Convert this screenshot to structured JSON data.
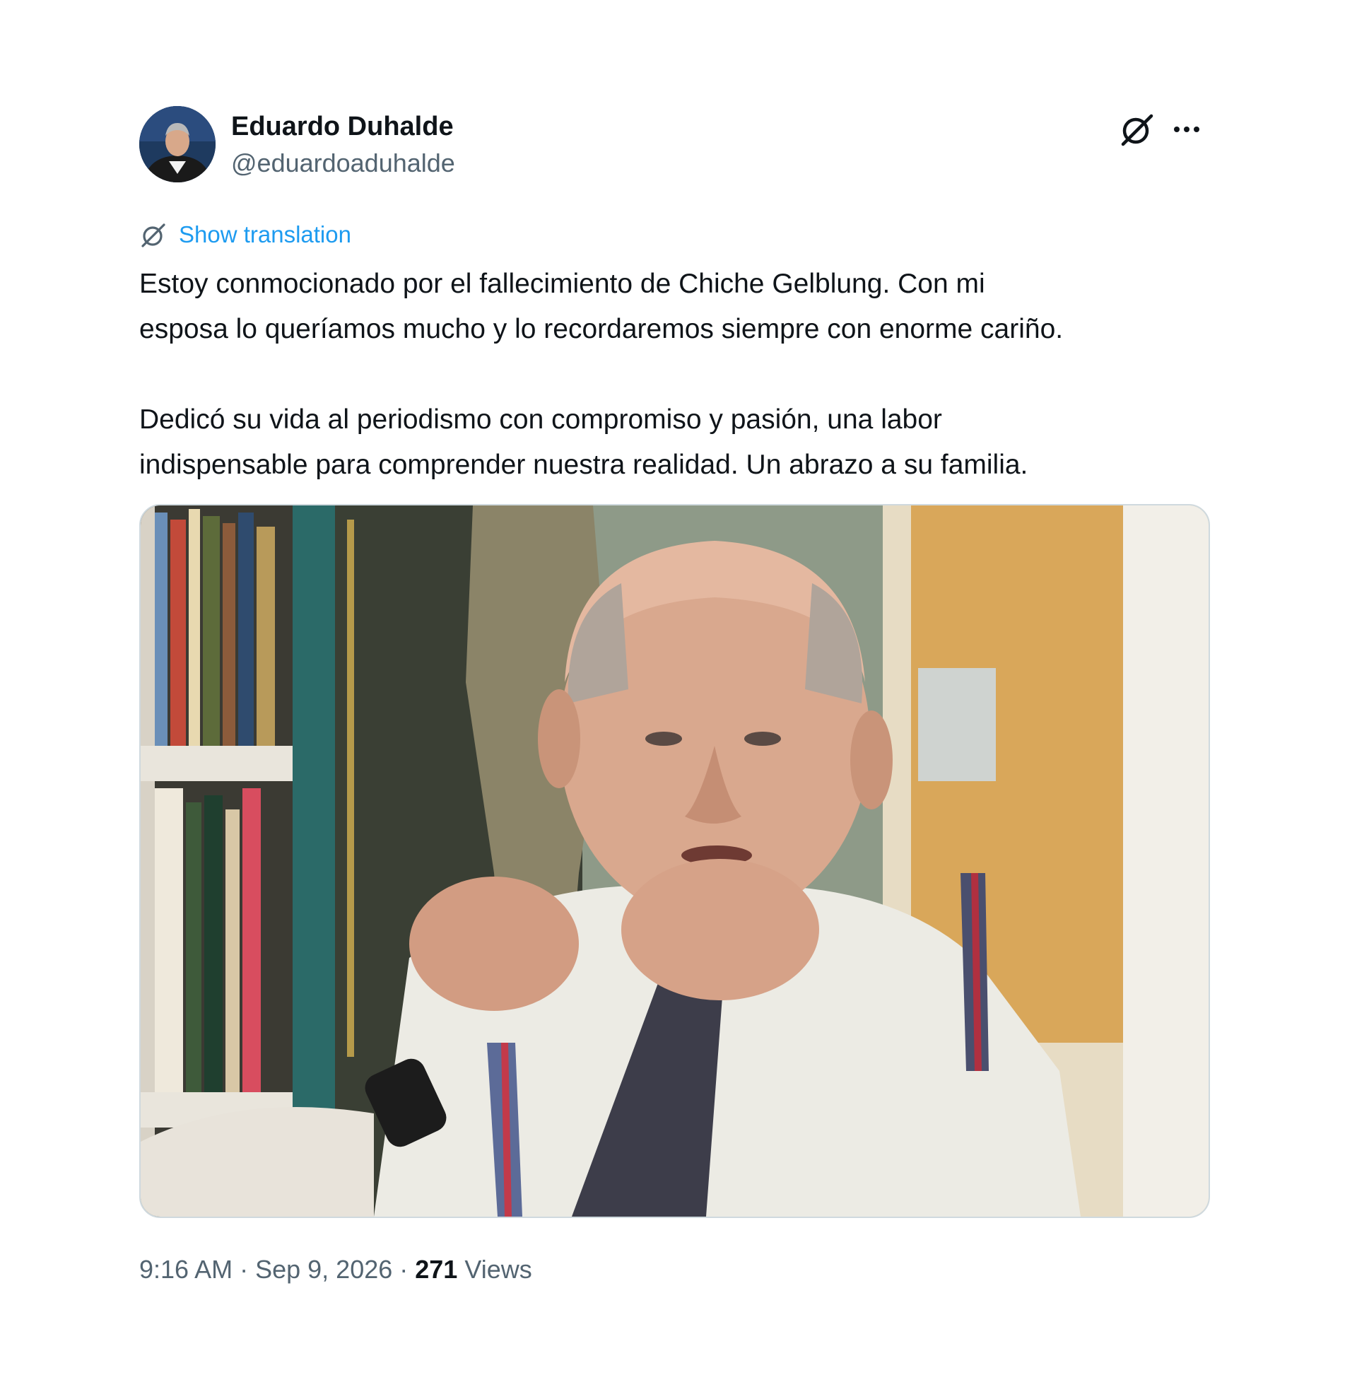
{
  "author": {
    "display_name": "Eduardo Duhalde",
    "handle": "@eduardoaduhalde",
    "avatar_icon": "profile-photo"
  },
  "actions": {
    "grok_icon": "grok-icon",
    "more_icon": "more-horizontal-icon"
  },
  "translation": {
    "icon": "grok-icon",
    "label": "Show translation"
  },
  "tweet": {
    "paragraph1_line1": "Estoy conmocionado por el fallecimiento de Chiche Gelblung. Con mi",
    "paragraph1_line2": "esposa lo queríamos mucho y lo recordaremos siempre con enorme cariño.",
    "paragraph2_line1": "Dedicó su vida al periodismo con compromiso y pasión, una labor",
    "paragraph2_line2": "indispensable para comprender nuestra realidad. Un abrazo a su familia."
  },
  "media": {
    "type": "photo"
  },
  "meta": {
    "time": "9:16 AM",
    "separator": " · ",
    "date": "Sep 9, 2026",
    "views_count": "271",
    "views_label": "Views"
  },
  "colors": {
    "link_blue": "#1d9bf0",
    "text_primary": "#0f1419",
    "text_secondary": "#536471",
    "border": "#cfd9de"
  }
}
